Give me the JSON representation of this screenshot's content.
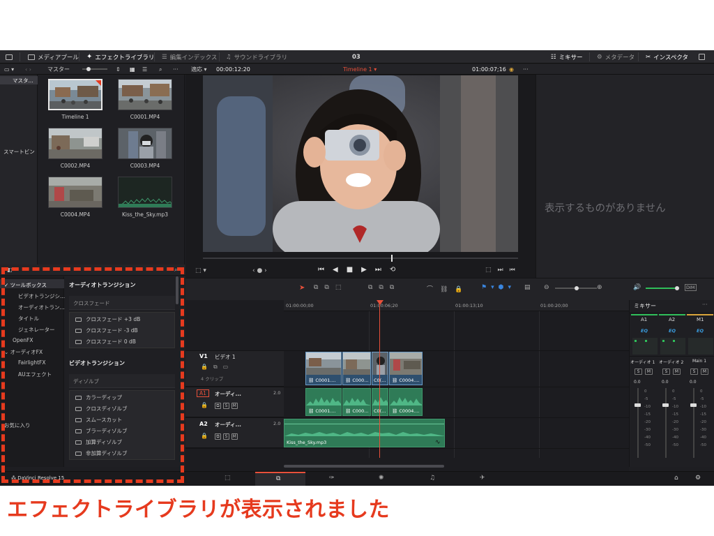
{
  "topbar": {
    "media_pool": "メディアプール",
    "effects_library": "エフェクトライブラリ",
    "edit_index": "編集インデックス",
    "sound_library": "サウンドライブラリ",
    "project_title": "03",
    "mixer": "ミキサー",
    "metadata": "メタデータ",
    "inspector": "インスペクタ"
  },
  "subbar": {
    "master": "マスター",
    "fit": "適応",
    "source_tc": "00:00:12:20",
    "timeline_name": "Timeline 1",
    "record_tc": "01:00:07;16"
  },
  "bins": {
    "master": "マスタ...",
    "smart_bins": "スマートビン"
  },
  "media_pool": {
    "items": [
      {
        "label": "Timeline 1"
      },
      {
        "label": "C0001.MP4"
      },
      {
        "label": "C0002.MP4"
      },
      {
        "label": "C0003.MP4"
      },
      {
        "label": "C0004.MP4"
      },
      {
        "label": "Kiss_the_Sky.mp3"
      }
    ]
  },
  "inspector": {
    "empty_text": "表示するものがありません"
  },
  "effects": {
    "tree": {
      "toolbox": "ツールボックス",
      "video_transitions": "ビデオトランジシ...",
      "audio_transitions": "オーディオトラン...",
      "titles": "タイトル",
      "generators": "ジェネレーター",
      "openfx": "OpenFX",
      "audio_fx": "オーディオFX",
      "fairlight_fx": "FairlightFX",
      "au_effects": "AUエフェクト",
      "favorites": "お気に入り"
    },
    "audio_header": "オーディオトランジション",
    "crossfade_group": "クロスフェード",
    "audio_items": [
      "クロスフェード +3 dB",
      "クロスフェード -3 dB",
      "クロスフェード 0 dB"
    ],
    "video_header": "ビデオトランジション",
    "dissolve_group": "ディゾルブ",
    "video_items": [
      "カラーディップ",
      "クロスディゾルブ",
      "スムースカット",
      "ブラーディゾルブ",
      "加算ディゾルブ",
      "非加算ディゾルブ"
    ]
  },
  "timeline": {
    "ruler": [
      "01:00:00;00",
      "01:00:06;20",
      "01:00:13;10",
      "01:00:20;00"
    ],
    "v1": {
      "id": "V1",
      "name": "ビデオ 1",
      "clips_count": "4 クリップ"
    },
    "a1": {
      "id": "A1",
      "name": "オーディ...",
      "level": "2.0"
    },
    "a2": {
      "id": "A2",
      "name": "オーディ...",
      "level": "2.0"
    },
    "video_clips": [
      "C0001....",
      "C000...",
      "C0(...",
      "C0004...."
    ],
    "audio_clips": [
      "C0001....",
      "C000...",
      "C0(...",
      "C0004...."
    ],
    "music_clip": "Kiss_the_Sky.mp3"
  },
  "mixer": {
    "title": "ミキサー",
    "channels": [
      "A1",
      "A2",
      "M1"
    ],
    "eq": "EQ",
    "strips": [
      "オーディオ 1",
      "オーディオ 2",
      "Main 1"
    ],
    "levels": [
      "0.0",
      "0.0",
      "0.0"
    ],
    "scale": [
      "0",
      "-5",
      "-10",
      "-15",
      "-20",
      "-30",
      "-40",
      "-50"
    ],
    "solo": "S",
    "mute": "M"
  },
  "footer": {
    "app_name": "DaVinci Resolve 15"
  },
  "caption": "エフェクトライブラリが表示されました",
  "colors": {
    "accent_red": "#e63a1e",
    "audio_green": "#2f7b57",
    "video_blue": "#2e4f6e"
  }
}
